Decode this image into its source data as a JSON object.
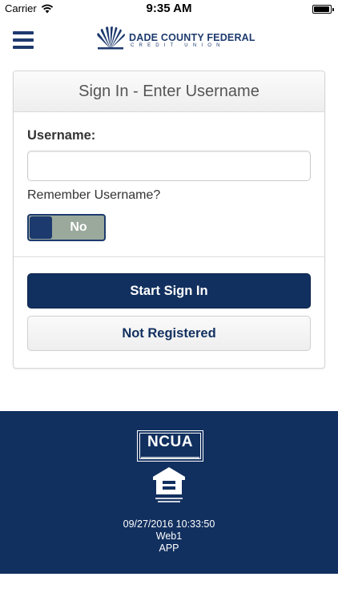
{
  "status_bar": {
    "carrier": "Carrier",
    "time": "9:35 AM"
  },
  "header": {
    "logo_name": "DADE COUNTY FEDERAL",
    "logo_sub": "CREDIT UNION",
    "brand_color": "#1d3a6e"
  },
  "card": {
    "title": "Sign In - Enter Username",
    "username_label": "Username:",
    "username_value": "",
    "username_placeholder": "",
    "remember_label": "Remember Username?",
    "remember_toggle": "No",
    "start_button": "Start Sign In",
    "not_registered_button": "Not Registered"
  },
  "footer": {
    "ncua_badge": "NCUA",
    "equal_housing_icon": "equal-housing-opportunity-icon",
    "timestamp": "09/27/2016 10:33:50",
    "server": "Web1",
    "channel": "APP",
    "background_color": "#12305f"
  }
}
